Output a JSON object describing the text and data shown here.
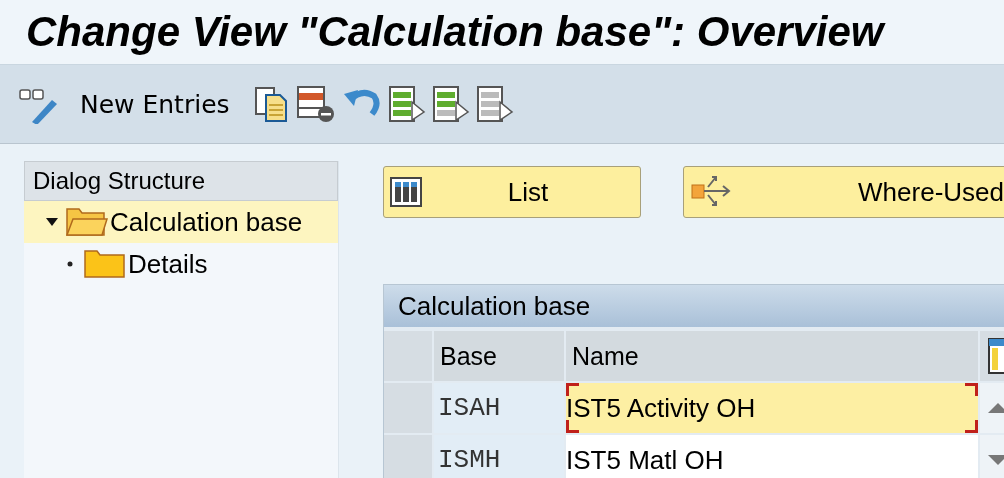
{
  "window": {
    "title": "Change View \"Calculation base\": Overview"
  },
  "toolbar": {
    "new_entries": "New Entries"
  },
  "dialog_structure": {
    "title": "Dialog Structure",
    "items": [
      {
        "label": "Calculation base",
        "selected": true,
        "expanded": true,
        "children": [
          {
            "label": "Details",
            "selected": false,
            "expanded": false
          }
        ]
      }
    ]
  },
  "buttons": [
    {
      "label": "List",
      "kind": "list"
    },
    {
      "label": "Where-Used",
      "kind": "where-used"
    }
  ],
  "table": {
    "title": "Calculation base",
    "columns": [
      "Base",
      "Name"
    ],
    "rows": [
      {
        "base": "ISAH",
        "name": "IST5 Activity OH",
        "focused": true
      },
      {
        "base": "ISMH",
        "name": "IST5 Matl OH",
        "focused": false
      }
    ]
  }
}
